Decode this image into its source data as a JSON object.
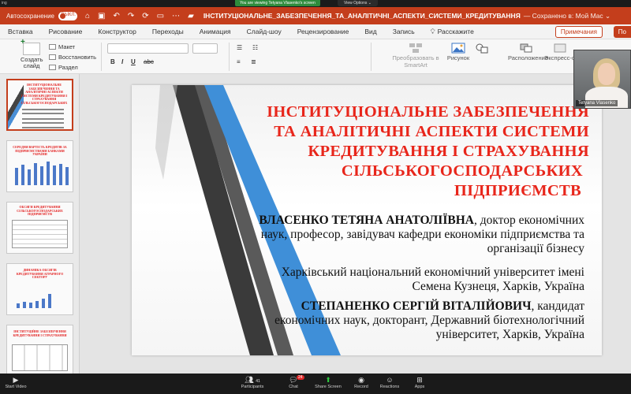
{
  "zoom": {
    "viewing_banner": "You are viewing Tetyana Vlasenko's screen",
    "view_options": "View Options ⌄",
    "corner_text": "ing",
    "participant_name": "Tetyana Vlasenko",
    "toolbar": {
      "start_video": "Start Video",
      "participants": "Participants",
      "participants_count": "41",
      "chat": "Chat",
      "chat_badge": "24",
      "share_screen": "Share Screen",
      "record": "Record",
      "reactions": "Reactions",
      "apps": "Apps"
    }
  },
  "titlebar": {
    "autosave_label": "Автосохранение",
    "autosave_state": "ВЫКЛ.",
    "document_title": "ІНСТИТУЦІОНАЛЬНЕ_ЗАБЕЗПЕЧЕННЯ_ТА_АНАЛІТИЧНІ_АСПЕКТИ_СИСТЕМИ_КРЕДИТУВАННЯ",
    "saved_status": "— Сохранено в: Мой Mac ⌄"
  },
  "tabs": [
    "Вставка",
    "Рисование",
    "Конструктор",
    "Переходы",
    "Анимация",
    "Слайд-шоу",
    "Рецензирование",
    "Вид",
    "Запись"
  ],
  "tell_me": "Расскажите",
  "notes_button": "Примечания",
  "share_button": "По",
  "ribbon": {
    "new_slide": "Создать слайд",
    "layout": "Макет",
    "reset": "Восстановить",
    "section": "Раздел",
    "convert_smartart": "Преобразовать в SmartArt",
    "picture": "Рисунок",
    "arrange": "Расположение",
    "express_styles": "Экспресс-сти"
  },
  "thumbnails": [
    {
      "number": "",
      "title": "ІНСТИТУЦІОНАЛЬНЕ ЗАБЕЗПЕЧЕННЯ ТА АНАЛІТИЧНІ АСПЕКТИ СИСТЕМИ КРЕДИТУВАННЯ І СТРАХУВАННЯ СІЛЬСЬКОГОСПОДАРСЬКИХ"
    },
    {
      "number": "",
      "title": "СЕРЕДНЯ ВАРТІСТЬ КРЕДИТІВ ЗА ПІДПРИЄМСТВАМИ БАНКАМИ УКРАЇНИ"
    },
    {
      "number": "",
      "title": "ОБСЯГИ КРЕДИТУВАННЯ СІЛЬСЬКОГОСПОДАРСЬКИХ ПІДПРИЄМСТВ"
    },
    {
      "number": "",
      "title": "ДИНАМІКА ОБСЯГІВ КРЕДИТУВАННЯ АГРАРНОГО СЕКТОРУ"
    },
    {
      "number": "",
      "title": "ІНСТИТУЦІЙНЕ ЗАБЕЗПЕЧЕННЯ КРЕДИТУВАННЯ І СТРАХУВАННЯ"
    }
  ],
  "slide": {
    "title_lines": [
      "ІНСТИТУЦІОНАЛЬНЕ ЗАБЕЗПЕЧЕННЯ",
      "ТА АНАЛІТИЧНІ АСПЕКТИ СИСТЕМИ",
      "КРЕДИТУВАННЯ І СТРАХУВАННЯ",
      "СІЛЬСЬКОГОСПОДАРСЬКИХ",
      "ПІДПРИЄМСТВ"
    ],
    "author1_name": "ВЛАСЕНКО ТЕТЯНА АНАТОЛІЇВНА",
    "author1_rest1": ", доктор економічних",
    "author1_rest2": "наук, професор, завідувач кафедри економіки підприємства та",
    "author1_rest3": "організації бізнесу",
    "affil1_line1": "Харківський національний економічний університет імені",
    "affil1_line2": "Семена Кузнеця, Харків, Україна",
    "author2_name": "СТЕПАНЕНКО СЕРГІЙ ВІТАЛІЙОВИЧ",
    "author2_rest1": ", кандидат",
    "author2_rest2": "економічних наук, докторант, Державний біотехнологічний",
    "author2_rest3": "університет, Харків, Україна"
  },
  "colors": {
    "ppt_accent": "#c43e1c",
    "title_red": "#e8261b",
    "deco_dark": "#3a3a3a",
    "deco_blue": "#3f8fd8"
  }
}
